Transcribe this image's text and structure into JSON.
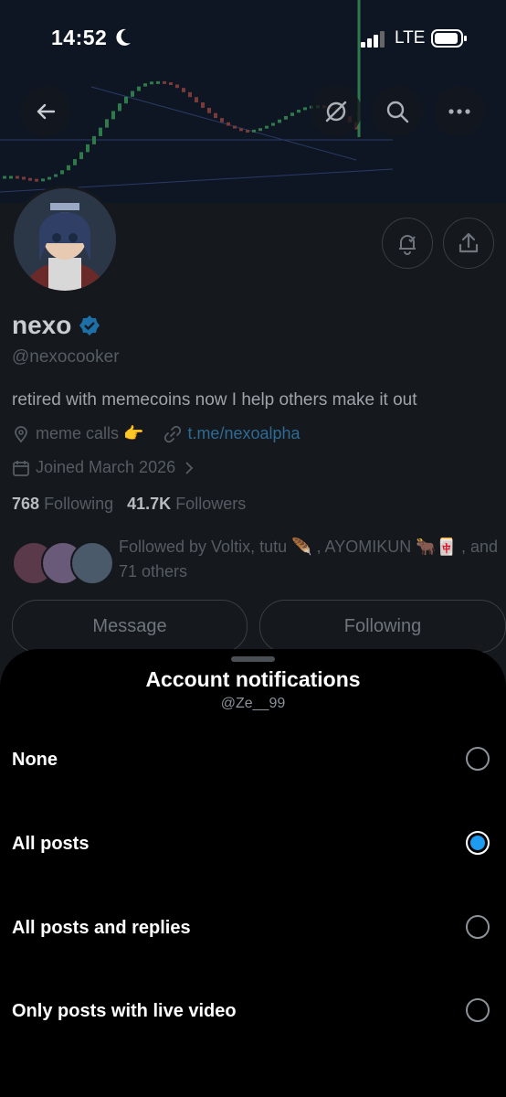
{
  "status_bar": {
    "time": "14:52",
    "network": "LTE"
  },
  "profile": {
    "name": "nexo",
    "handle": "@nexocooker",
    "bio": "retired with memecoins now I help others make it out",
    "category": "meme calls 👉",
    "link": "t.me/nexoalpha",
    "joined": "Joined March 2026",
    "following_count": "768",
    "following_label": "Following",
    "followers_count": "41.7K",
    "followers_label": "Followers",
    "followed_by": "Followed by Voltix, tutu 🪶 , AYOMIKUN 🐂🀄 , and 71 others",
    "message_button": "Message",
    "following_button": "Following"
  },
  "icons": {
    "back": "arrow-left-icon",
    "grok": "grok-icon",
    "search": "search-icon",
    "more": "more-icon",
    "notify": "bell-icon",
    "share": "share-icon",
    "verified": "verified-badge-icon"
  },
  "colors": {
    "accent": "#1d9bf0",
    "sheet_bg": "#000000",
    "verified": "#1d9bf0"
  },
  "sheet": {
    "title": "Account notifications",
    "subtitle": "@Ze__99",
    "options": [
      {
        "label": "None",
        "selected": false
      },
      {
        "label": "All posts",
        "selected": true
      },
      {
        "label": "All posts and replies",
        "selected": false
      },
      {
        "label": "Only posts with live video",
        "selected": false
      }
    ]
  }
}
